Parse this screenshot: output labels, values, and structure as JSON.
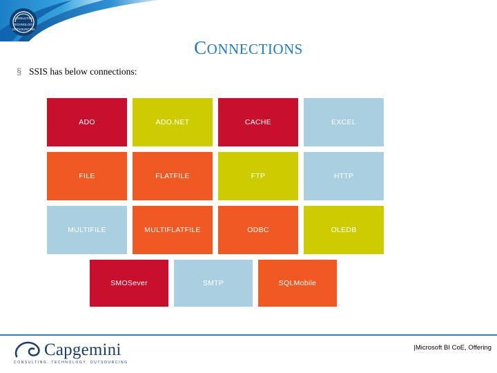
{
  "slide": {
    "title_first_letter": "C",
    "title_rest": "ONNECTIONS",
    "bullet_marker": "§",
    "bullet_text": "SSIS has below connections:"
  },
  "tiles": [
    [
      {
        "label": "ADO",
        "color": "#C8102E"
      },
      {
        "label": "ADO.NET",
        "color": "#CCCC00"
      },
      {
        "label": "CACHE",
        "color": "#C8102E"
      },
      {
        "label": "EXCEL",
        "color": "#A9CFE0"
      }
    ],
    [
      {
        "label": "FILE",
        "color": "#F05A22"
      },
      {
        "label": "FLATFILE",
        "color": "#F05A22"
      },
      {
        "label": "FTP",
        "color": "#CCCC00"
      },
      {
        "label": "HTTP",
        "color": "#A9CFE0"
      }
    ],
    [
      {
        "label": "MULTIFILE",
        "color": "#A9CFE0"
      },
      {
        "label": "MULTIFLATFILE",
        "color": "#F05A22"
      },
      {
        "label": "ODBC",
        "color": "#F05A22"
      },
      {
        "label": "OLEDB",
        "color": "#CCCC00"
      }
    ],
    [
      {
        "label": "SMOSever",
        "color": "#C8102E"
      },
      {
        "label": "SMTP",
        "color": "#A9CFE0"
      },
      {
        "label": "SQLMobile",
        "color": "#F05A22"
      }
    ]
  ],
  "footer": {
    "note": "|Microsoft BI CoE, Offering"
  },
  "logo": {
    "wordmark": "Capgemini",
    "tagline": "CONSULTING. TECHNOLOGY. OUTSOURCING"
  },
  "theme": {
    "title_color": "#1F7BC4",
    "banner_blue": "#1F7BC4",
    "banner_dark_blue": "#0E5FA8",
    "footer_rule_color": "#2A7FC9"
  }
}
